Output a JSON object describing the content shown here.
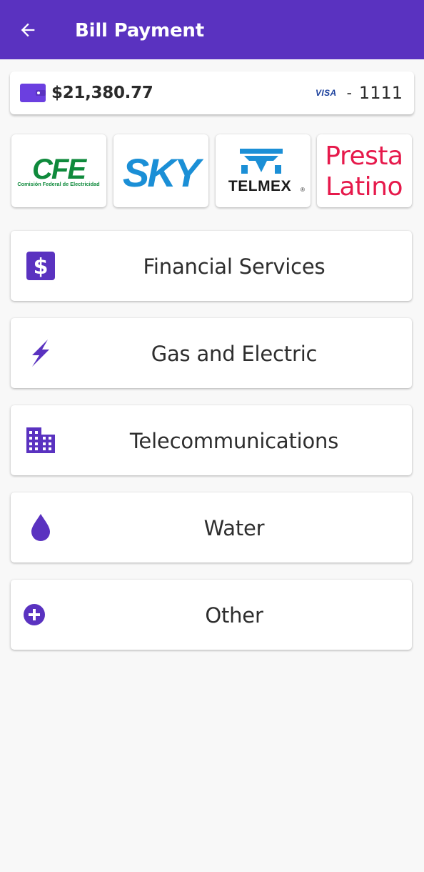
{
  "header": {
    "title": "Bill Payment",
    "back_icon": "arrow-left-icon",
    "background": "#5a32c0"
  },
  "balance": {
    "amount": "$21,380.77",
    "wallet_icon": "wallet-icon",
    "card_brand": "VISA",
    "card_separator": "-",
    "card_last4": "1111"
  },
  "billers": [
    {
      "name": "CFE",
      "subtitle": "Comisión Federal de Electricidad",
      "color": "#0f8a3c"
    },
    {
      "name": "SKY",
      "color": "#1b8fd6"
    },
    {
      "name": "TELMEX",
      "mark": "®",
      "color": "#1b8fd6"
    },
    {
      "name_line1": "Presta",
      "name_line2": "Latino",
      "color": "#e6194b"
    }
  ],
  "categories": [
    {
      "label": "Financial Services",
      "icon": "dollar-icon"
    },
    {
      "label": "Gas and Electric",
      "icon": "lightning-icon"
    },
    {
      "label": "Telecommunications",
      "icon": "building-icon"
    },
    {
      "label": "Water",
      "icon": "water-drop-icon"
    },
    {
      "label": "Other",
      "icon": "plus-circle-icon"
    }
  ],
  "accent_color": "#5a32c0"
}
